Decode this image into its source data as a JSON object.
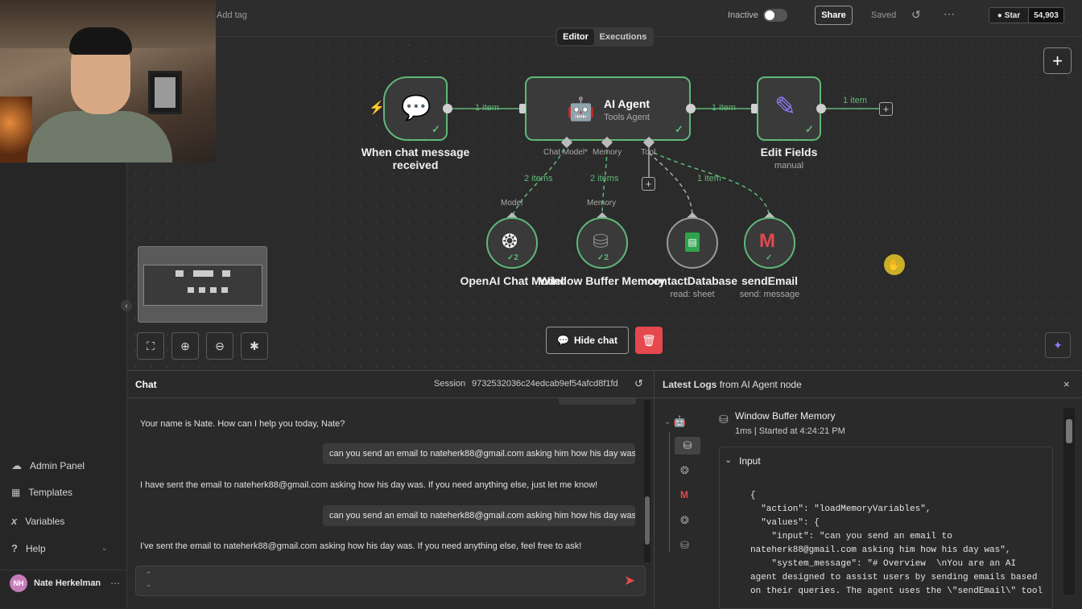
{
  "topbar": {
    "add_tag": "Add tag",
    "inactive_label": "Inactive",
    "share_label": "Share",
    "saved_label": "Saved",
    "star_label": "Star",
    "star_count": "54,903"
  },
  "tabs": [
    {
      "label": "Editor",
      "active": true
    },
    {
      "label": "Executions",
      "active": false
    }
  ],
  "nodes": {
    "chat_trigger": {
      "title": "When chat message received"
    },
    "ai_agent": {
      "title": "AI Agent",
      "subtitle": "Tools Agent",
      "port_chat_model": "Chat Model*",
      "port_memory": "Memory",
      "port_tool": "Tool"
    },
    "edit_fields": {
      "title": "Edit Fields",
      "subtitle": "manual"
    },
    "openai": {
      "title": "OpenAI Chat Model",
      "count": "2",
      "port": "Model"
    },
    "memory": {
      "title": "Window Buffer Memory",
      "count": "2",
      "port": "Memory"
    },
    "contact_db": {
      "title": "contactDatabase",
      "subtitle": "read: sheet"
    },
    "send_email": {
      "title": "sendEmail",
      "subtitle": "send: message"
    }
  },
  "edges": {
    "trigger_to_agent": "1 item",
    "agent_to_fields": "1 item",
    "fields_out": "1 item",
    "model_edge": "2 items",
    "memory_edge": "2 items",
    "tool_edge": "1 item"
  },
  "canvas_controls": {
    "hide_chat": "Hide chat"
  },
  "sidebar": {
    "items": [
      {
        "label": "Admin Panel",
        "icon": "cloud-icon"
      },
      {
        "label": "Templates",
        "icon": "templates-icon"
      },
      {
        "label": "Variables",
        "icon": "variables-icon"
      },
      {
        "label": "Help",
        "icon": "help-icon"
      }
    ],
    "user": {
      "initials": "NH",
      "name": "Nate Herkelman"
    }
  },
  "chat": {
    "title": "Chat",
    "session_label": "Session",
    "session_id": "9732532036c24edcab9ef54afcd8f1fd",
    "messages": [
      {
        "role": "bot",
        "text": "Your name is Nate. How can I help you today, Nate?"
      },
      {
        "role": "user",
        "text": "can you send an email to nateherk88@gmail.com asking him how his day was"
      },
      {
        "role": "bot",
        "text": "I have sent the email to nateherk88@gmail.com asking how his day was. If you need anything else, just let me know!"
      },
      {
        "role": "user",
        "text": "can you send an email to nateherk88@gmail.com asking him how his day was"
      },
      {
        "role": "bot",
        "text": "I've sent the email to nateherk88@gmail.com asking how his day was. If you need anything else, feel free to ask!"
      }
    ]
  },
  "logs": {
    "title_prefix": "Latest Logs",
    "title_suffix": "from AI Agent node",
    "entry_title": "Window Buffer Memory",
    "entry_meta": "1ms | Started at 4:24:21 PM",
    "section": "Input",
    "json_lines": [
      "{",
      "  \"action\": \"loadMemoryVariables\",",
      "  \"values\": {",
      "    \"input\": \"can you send an email to",
      "nateherk88@gmail.com asking him how his day was\",",
      "    \"system_message\": \"# Overview  \\nYou are an AI",
      "agent designed to assist users by sending emails based",
      "on their queries. The agent uses the \\\"sendEmail\\\" tool"
    ]
  },
  "colors": {
    "accent_green": "#5fb878",
    "delete_red": "#e5484d",
    "send_red": "#e5484d",
    "edit_purple": "#8b7cf6"
  }
}
